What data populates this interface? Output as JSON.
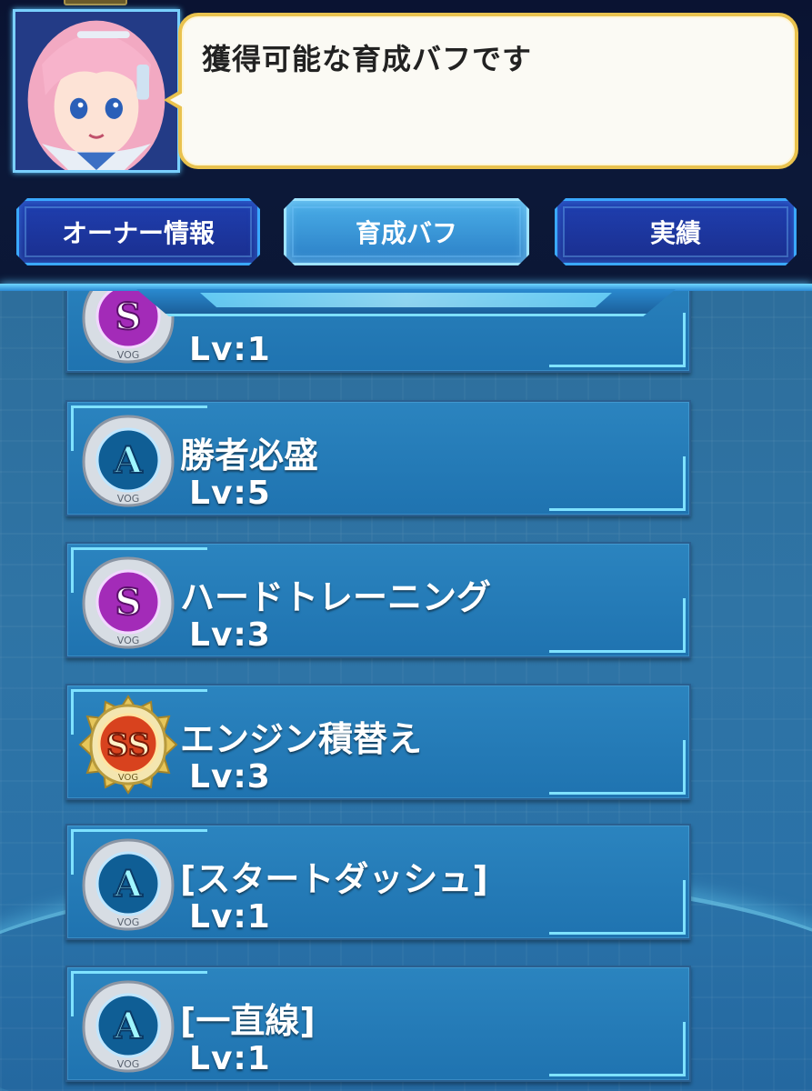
{
  "speech": {
    "text": "獲得可能な育成バフです"
  },
  "tabs": [
    {
      "label": "オーナー情報",
      "active": false
    },
    {
      "label": "育成バフ",
      "active": true
    },
    {
      "label": "実績",
      "active": false
    }
  ],
  "buffs": [
    {
      "rank": "S",
      "name": "",
      "level": "Lv:1"
    },
    {
      "rank": "A",
      "name": "勝者必盛",
      "level": "Lv:5"
    },
    {
      "rank": "S",
      "name": "ハードトレーニング",
      "level": "Lv:3"
    },
    {
      "rank": "SS",
      "name": "エンジン積替え",
      "level": "Lv:3"
    },
    {
      "rank": "A",
      "name": "[スタートダッシュ]",
      "level": "Lv:1"
    },
    {
      "rank": "A",
      "name": "[一直線]",
      "level": "Lv:1"
    }
  ],
  "badge_text": "VOG",
  "colors": {
    "rank_A": "#0f6fa8",
    "rank_S": "#c23bd0",
    "rank_SS": "#d6341c",
    "accent": "#7fe2ff"
  }
}
